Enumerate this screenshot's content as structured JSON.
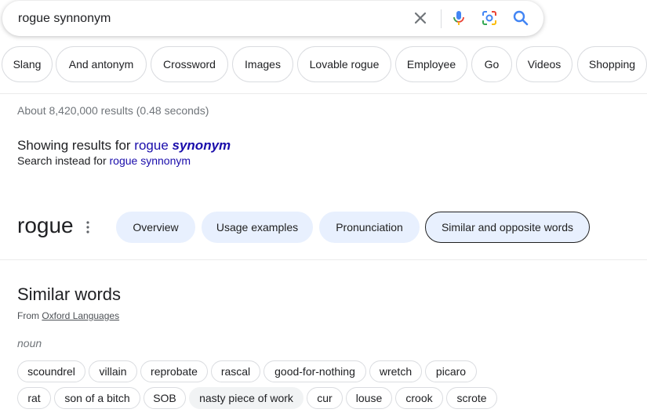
{
  "search": {
    "query": "rogue synnonym"
  },
  "icons": {
    "clear": "close-icon",
    "voice": "mic-icon",
    "lens": "lens-icon",
    "search": "search-icon",
    "more": "more-vert-icon"
  },
  "colors": {
    "link": "#1a0dab",
    "accent_chip": "#e8f0fe",
    "mic_blue": "#4285f4",
    "mic_red": "#ea4335",
    "mic_yellow": "#fbbc04",
    "mic_green": "#34a853"
  },
  "filter_chips": [
    "Slang",
    "And antonym",
    "Crossword",
    "Images",
    "Lovable rogue",
    "Employee",
    "Go",
    "Videos",
    "Shopping"
  ],
  "results_stats": "About 8,420,000 results (0.48 seconds)",
  "correction": {
    "prefix": "Showing results for ",
    "word1": "rogue",
    "word2": "synonym",
    "instead_prefix": "Search instead for ",
    "instead_link": "rogue synnonym"
  },
  "dictionary": {
    "word": "rogue",
    "tabs": [
      "Overview",
      "Usage examples",
      "Pronunciation",
      "Similar and opposite words"
    ],
    "selected_tab": "Similar and opposite words",
    "section_title": "Similar words",
    "from_prefix": "From ",
    "source": "Oxford Languages",
    "part_of_speech": "noun",
    "row1": [
      "scoundrel",
      "villain",
      "reprobate",
      "rascal",
      "good-for-nothing",
      "wretch",
      "picaro"
    ],
    "row2": [
      "rat",
      "son of a bitch",
      "SOB",
      "nasty piece of work",
      "cur",
      "louse",
      "crook",
      "scrote"
    ],
    "highlighted_word": "nasty piece of work"
  }
}
